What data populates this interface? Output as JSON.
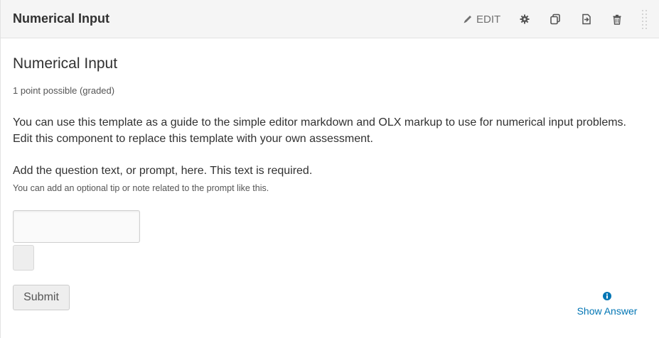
{
  "header": {
    "title": "Numerical Input",
    "edit_label": "EDIT",
    "icons": [
      "pencil-icon",
      "gear-icon",
      "duplicate-icon",
      "move-icon",
      "trash-icon",
      "drag-handle-icon"
    ]
  },
  "problem": {
    "title": "Numerical Input",
    "points": "1 point possible (graded)",
    "intro": "You can use this template as a guide to the simple editor markdown and OLX markup to use for numerical input problems. Edit this component to replace this template with your own assessment.",
    "question": "Add the question text, or prompt, here. This text is required.",
    "tip": "You can add an optional tip or note related to the prompt like this.",
    "answer_value": ""
  },
  "actions": {
    "submit_label": "Submit",
    "show_answer_label": "Show Answer"
  },
  "colors": {
    "link": "#0075b4",
    "header_bg": "#f5f5f5",
    "icon": "#707070"
  }
}
